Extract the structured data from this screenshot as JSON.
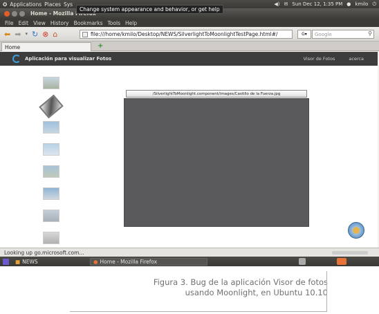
{
  "top_panel": {
    "applications": "Applications",
    "places": "Places",
    "system": "Sys",
    "tooltip": "Change system appearance and behavior, or get help",
    "datetime": "Sun Dec 12, 1:35 PM",
    "user": "kmilo"
  },
  "window": {
    "title": "Home - Mozilla Firefox"
  },
  "menubar": [
    "File",
    "Edit",
    "View",
    "History",
    "Bookmarks",
    "Tools",
    "Help"
  ],
  "navbar": {
    "url": "file:///home/kmilo/Desktop/NEWS/SilverlightToMoonlightTestPage.html#/",
    "search_placeholder": "Google"
  },
  "tab": {
    "label": "Home"
  },
  "app": {
    "title": "Aplicación para visualizar Fotos",
    "nav": [
      "Visor de Fotos",
      "acerca"
    ],
    "photo_caption": "/SilverlightToMoonlight.component/images/Castillo de la Fuerza.jpg",
    "thumbnail_count": 8,
    "selected_thumbnail": 2
  },
  "status": {
    "text": "Looking up go.microsoft.com..."
  },
  "taskbar": {
    "news": "NEWS",
    "firefox": "Home - Mozilla Firefox"
  },
  "caption": {
    "line1": "Figura 3. Bug de la aplicación Visor de fotos",
    "line2": "usando Moonlight, en Ubuntu 10.10"
  },
  "colors": {
    "panel": "#3c3b37",
    "app_header": "#3d3d3d",
    "photo_frame": "#5a595b",
    "close_button": "#e05d2c"
  }
}
